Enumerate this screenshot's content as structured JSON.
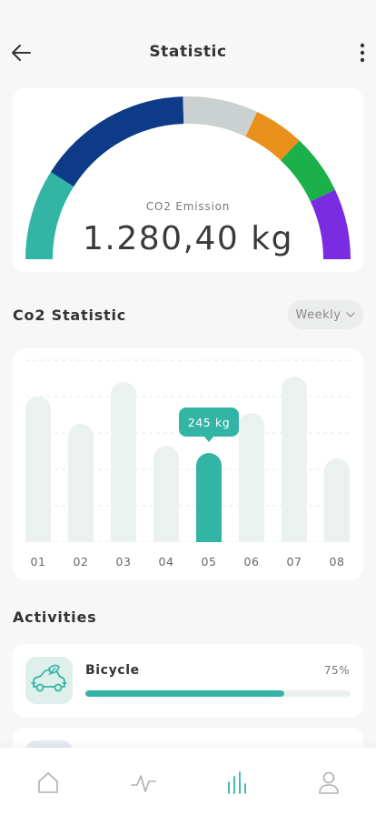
{
  "header": {
    "title": "Statistic",
    "back_icon": "arrow-left-icon",
    "menu_icon": "more-vertical-icon"
  },
  "gauge": {
    "label": "CO2 Emission",
    "value": "1.280,40 kg",
    "segments": [
      {
        "color": "#33b5a5",
        "fraction": 0.18
      },
      {
        "color": "#0d3b87",
        "fraction": 0.31
      },
      {
        "color": "#cbd1d1",
        "fraction": 0.15
      },
      {
        "color": "#e8901a",
        "fraction": 0.1
      },
      {
        "color": "#1bb04a",
        "fraction": 0.12
      },
      {
        "color": "#7a2de0",
        "fraction": 0.14
      }
    ]
  },
  "statistic": {
    "title": "Co2 Statistic",
    "period": "Weekly",
    "period_icon": "chevron-down-icon"
  },
  "chart_data": {
    "type": "bar",
    "categories": [
      "01",
      "02",
      "03",
      "04",
      "05",
      "06",
      "07",
      "08"
    ],
    "values": [
      400,
      325,
      440,
      265,
      245,
      355,
      455,
      230
    ],
    "highlight_index": 4,
    "highlight_label": "245 kg",
    "ylim": [
      0,
      500
    ],
    "grid": true,
    "title": "",
    "xlabel": "",
    "ylabel": ""
  },
  "activities": {
    "title": "Activities",
    "items": [
      {
        "name": "Bicycle",
        "percent_label": "75%",
        "progress": 0.75,
        "icon": "car-leaf-icon"
      }
    ]
  },
  "nav": {
    "items": [
      {
        "icon": "home-icon",
        "active": false
      },
      {
        "icon": "activity-pulse-icon",
        "active": false
      },
      {
        "icon": "bar-chart-icon",
        "active": true
      },
      {
        "icon": "user-icon",
        "active": false
      }
    ],
    "accent": "#33b5a5",
    "inactive": "#b0b0b0"
  },
  "colors": {
    "accent": "#33b5a5",
    "bar_bg": "#eaf1ef"
  }
}
